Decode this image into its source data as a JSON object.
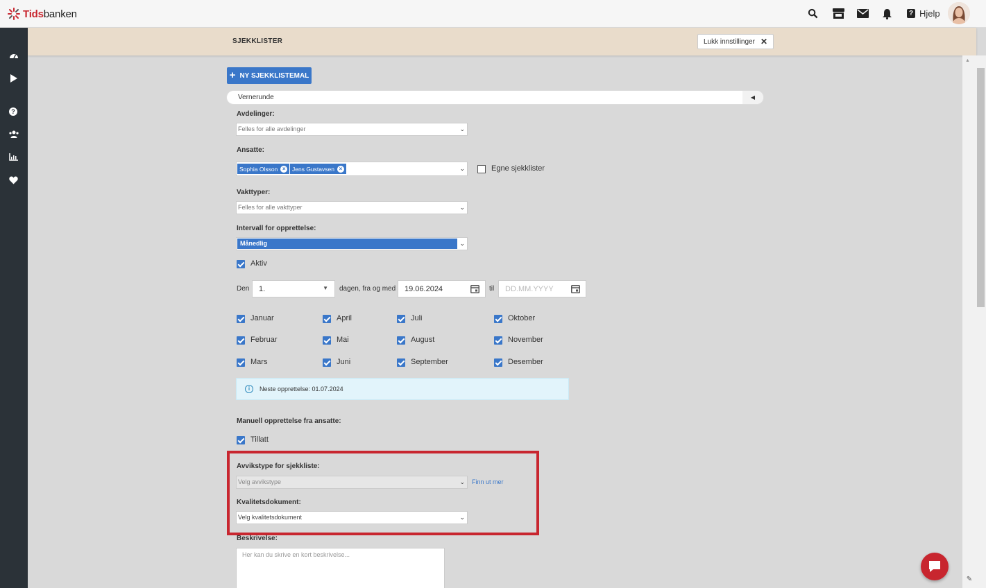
{
  "app": {
    "logo_text_prefix": "Tids",
    "logo_text_suffix": "banken"
  },
  "topbar": {
    "help_label": "Hjelp"
  },
  "settings": {
    "title": "SJEKKLISTER",
    "close_label": "Lukk innstillinger"
  },
  "toolbar": {
    "new_button_label": "NY SJEKKLISTEMAL"
  },
  "accordion": {
    "label": "Vernerunde"
  },
  "form": {
    "departments_label": "Avdelinger:",
    "departments_value": "Felles for alle avdelinger",
    "employees_label": "Ansatte:",
    "employees_tags": [
      "Sophia Olsson",
      "Jens Gustavsen"
    ],
    "own_checklists_label": "Egne sjekklister",
    "shift_types_label": "Vakttyper:",
    "shift_types_value": "Felles for alle vakttyper",
    "interval_label": "Intervall for opprettelse:",
    "interval_value": "Månedlig",
    "active_label": "Aktiv",
    "den_label": "Den",
    "day_value": "1.",
    "from_label": "dagen, fra og med",
    "from_date": "19.06.2024",
    "to_label": "til",
    "to_placeholder": "DD.MM.YYYY",
    "months": [
      "Januar",
      "Februar",
      "Mars",
      "April",
      "Mai",
      "Juni",
      "Juli",
      "August",
      "September",
      "Oktober",
      "November",
      "Desember"
    ],
    "next_creation": "Neste opprettelse: 01.07.2024",
    "manual_label": "Manuell opprettelse fra ansatte:",
    "allowed_label": "Tillatt",
    "deviation_label": "Avvikstype for sjekkliste:",
    "deviation_placeholder": "Velg avvikstype",
    "learn_more": "Finn ut mer",
    "quality_label": "Kvalitetsdokument:",
    "quality_placeholder": "Velg kvalitetsdokument",
    "description_label": "Beskrivelse:",
    "description_placeholder": "Her kan du skrive en kort beskrivelse..."
  },
  "colors": {
    "accent": "#3a77c9",
    "brand_red": "#c8262f",
    "sidebar": "#2b3238",
    "settings_bar": "#e9dccb"
  },
  "icons": [
    "search-icon",
    "store-icon",
    "mail-icon",
    "bell-icon",
    "help-icon",
    "dashboard-icon",
    "play-icon",
    "question-icon",
    "users-icon",
    "chart-icon",
    "heart-icon",
    "chat-icon",
    "wrench-icon"
  ]
}
